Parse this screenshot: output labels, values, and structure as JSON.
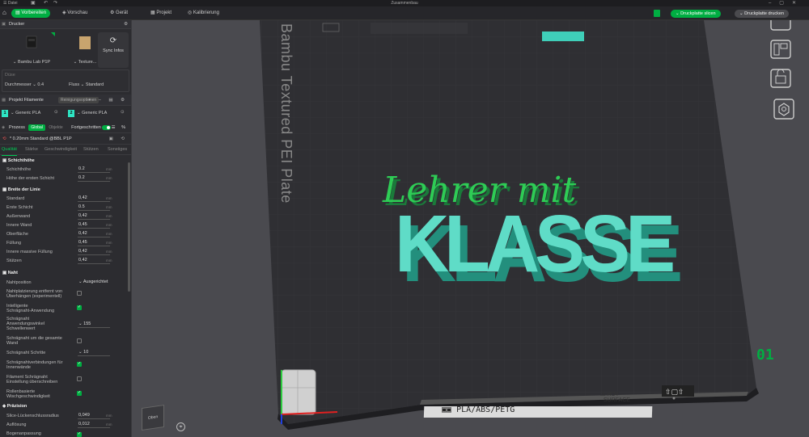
{
  "titlebar": {
    "menu": "Datei",
    "title": "Zusammenbau"
  },
  "toolbar": {
    "tabs": [
      {
        "label": "Vorbereiten"
      },
      {
        "label": "Vorschau"
      },
      {
        "label": "Gerät"
      },
      {
        "label": "Projekt"
      },
      {
        "label": "Kalibrierung"
      }
    ],
    "slice_button": "Druckplatte slicen",
    "print_button": "Druckplatte drucken"
  },
  "printer": {
    "section_title": "Drucker",
    "printer_name": "Bambu Lab P1P",
    "plate_name": "Texture...",
    "sync_label": "Sync Infos",
    "plate_box_title": "Düse",
    "nozzle_label": "Durchmesser",
    "nozzle_value": "0.4",
    "flow_label": "Fluss",
    "flow_value": "Standard"
  },
  "filament": {
    "section_title": "Projekt Filamente",
    "badge": "Reinigungsoptionen",
    "items": [
      {
        "num": "1",
        "name": "Generic PLA"
      },
      {
        "num": "2",
        "name": "Generic PLA"
      }
    ]
  },
  "process": {
    "title": "Prozess",
    "global": "Global",
    "objects": "Objekte",
    "advanced": "Fortgeschritten",
    "preset": "* 0.20mm Standard @BBL P1P",
    "tabs": [
      "Qualität",
      "Stärke",
      "Geschwindigkeit",
      "Stützen",
      "Sonstiges"
    ]
  },
  "params": {
    "g_layer": "Schichthöhe",
    "layer_height": {
      "label": "Schichthöhe",
      "value": "0.2",
      "unit": "mm"
    },
    "first_layer": {
      "label": "Höhe der ersten Schicht",
      "value": "0.2",
      "unit": "mm"
    },
    "g_width": "Breite der Linie",
    "w_default": {
      "label": "Standard",
      "value": "0,42",
      "unit": "mm"
    },
    "w_first": {
      "label": "Erste Schicht",
      "value": "0.5",
      "unit": "mm"
    },
    "w_outer": {
      "label": "Außenwand",
      "value": "0,42",
      "unit": "mm"
    },
    "w_inner": {
      "label": "Innere Wand",
      "value": "0,45",
      "unit": "mm"
    },
    "w_top": {
      "label": "Oberfläche",
      "value": "0,42",
      "unit": "mm"
    },
    "w_fill": {
      "label": "Füllung",
      "value": "0,45",
      "unit": "mm"
    },
    "w_solid": {
      "label": "Innere massive Füllung",
      "value": "0,42",
      "unit": "mm"
    },
    "w_support": {
      "label": "Stützen",
      "value": "0,42",
      "unit": "mm"
    },
    "g_seam": "Naht",
    "seam_pos": {
      "label": "Nahtposition",
      "value": "Ausgerichtet"
    },
    "seam_place": {
      "label1": "Nahtplatzierung entfernt von",
      "label2": "Überhängen (experimentell)"
    },
    "scarf_app": {
      "label1": "Intelligente",
      "label2": "Schrägnaht-Anwendung"
    },
    "scarf_angle": {
      "label1": "Schrägnaht",
      "label2": "Anwendungswinkel",
      "label3": "Schwellenwert",
      "value": "155"
    },
    "scarf_around": {
      "label1": "Schrägnaht um die gesamte",
      "label2": "Wand"
    },
    "scarf_steps": {
      "label": "Schrägnaht Schritte",
      "value": "10"
    },
    "scarf_inner": {
      "label1": "Schrägnahtverbindungen für",
      "label2": "Innenwände"
    },
    "scarf_fil": {
      "label1": "Filament Schrägnaht",
      "label2": "Einstellung überschreiben"
    },
    "role_speed": {
      "label1": "Rollenbasierte",
      "label2": "Wischgeschwindigkeit"
    },
    "g_precision": "Präzision",
    "slice_gap": {
      "label": "Slice-Lückenschlussradius",
      "value": "0,049",
      "unit": "mm"
    },
    "resolution": {
      "label": "Auflösung",
      "value": "0,012",
      "unit": "mm"
    },
    "arc_fit": {
      "label": "Bogenanpassung"
    }
  },
  "viewport": {
    "plate_label": "Bambu Textured PEI Plate",
    "model_line1": "Lehrer mit",
    "model_line2": "KLASSE",
    "plate_number": "01",
    "material_tag": "PLA/ABS/PETG",
    "hot_label1": "HOT",
    "hot_label2": "SURFACE",
    "cube_label": "Oben"
  }
}
